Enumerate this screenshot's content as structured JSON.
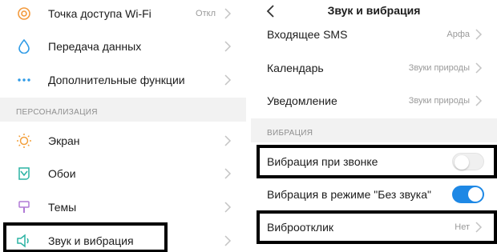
{
  "colors": {
    "accent": "#1e88e5",
    "highlight_border": "#000000"
  },
  "left": {
    "items_top": [
      {
        "label": "Точка доступа Wi-Fi",
        "value": "Откл",
        "icon": "hotspot-icon"
      },
      {
        "label": "Передача данных",
        "icon": "data-drop-icon"
      },
      {
        "label": "Дополнительные функции",
        "icon": "more-dots-icon"
      }
    ],
    "section_label": "ПЕРСОНАЛИЗАЦИЯ",
    "items_personal": [
      {
        "label": "Экран",
        "icon": "sun-icon"
      },
      {
        "label": "Обои",
        "icon": "wallpaper-icon"
      },
      {
        "label": "Темы",
        "icon": "themes-brush-icon"
      },
      {
        "label": "Звук и вибрация",
        "icon": "speaker-icon"
      }
    ]
  },
  "right": {
    "title": "Звук и вибрация",
    "items_top": [
      {
        "label": "Входящее SMS",
        "value": "Арфа"
      },
      {
        "label": "Календарь",
        "value": "Звуки природы"
      },
      {
        "label": "Уведомление",
        "value": "Звуки природы"
      }
    ],
    "section_label": "ВИБРАЦИЯ",
    "vibration": [
      {
        "label": "Вибрация при звонке",
        "toggle": "off"
      },
      {
        "label": "Вибрация в режиме \"Без звука\"",
        "toggle": "on"
      }
    ],
    "haptic": {
      "label": "Виброотклик",
      "value": "Нет"
    }
  }
}
